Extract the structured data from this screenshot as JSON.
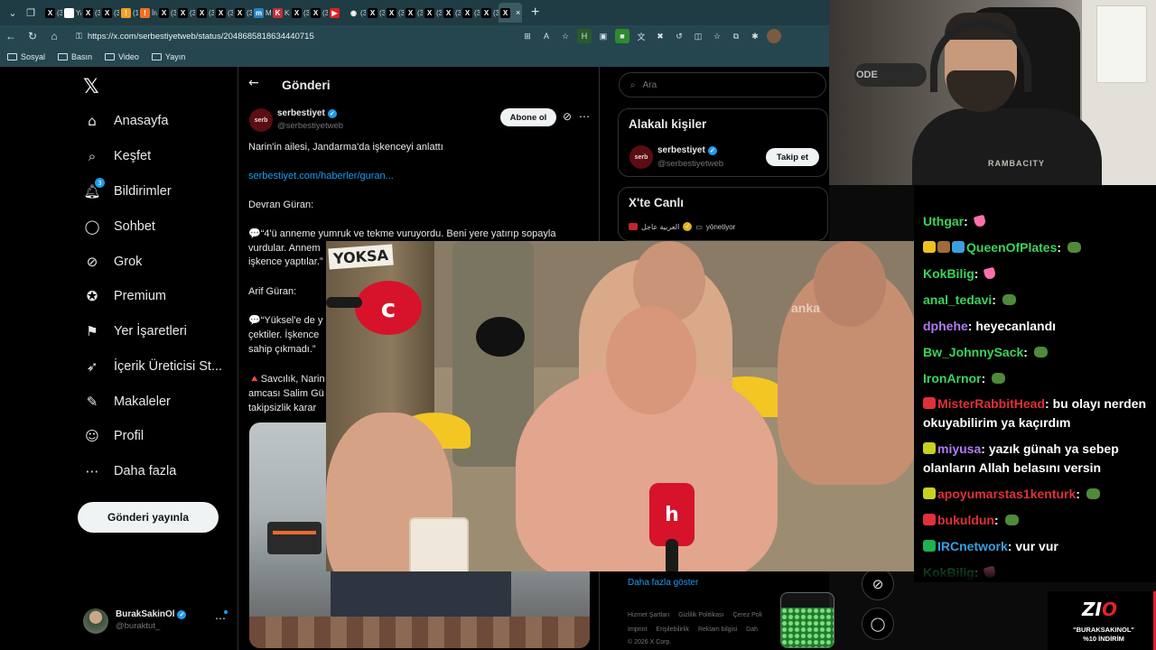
{
  "browser": {
    "tabs": [
      {
        "icon": "X",
        "label": "(3)",
        "color": "#000000"
      },
      {
        "icon": "Y",
        "label": "Yak",
        "color": "#ffffff"
      },
      {
        "icon": "X",
        "label": "(3)",
        "color": "#000000"
      },
      {
        "icon": "X",
        "label": "(3)",
        "color": "#000000"
      },
      {
        "icon": "!",
        "label": "(13",
        "color": "#f0a020"
      },
      {
        "icon": "!",
        "label": "İrar",
        "color": "#f07020"
      },
      {
        "icon": "X",
        "label": "(3)",
        "color": "#000000"
      },
      {
        "icon": "X",
        "label": "(3)",
        "color": "#000000"
      },
      {
        "icon": "X",
        "label": "(3)",
        "color": "#000000"
      },
      {
        "icon": "X",
        "label": "(3)",
        "color": "#000000"
      },
      {
        "icon": "X",
        "label": "(3)",
        "color": "#000000"
      },
      {
        "icon": "m",
        "label": "Mir",
        "color": "#2a7fc0"
      },
      {
        "icon": "K",
        "label": "Kicl",
        "color": "#c0303a"
      },
      {
        "icon": "X",
        "label": "(3)",
        "color": "#000000"
      },
      {
        "icon": "X",
        "label": "(3)",
        "color": "#000000"
      },
      {
        "icon": "▶",
        "label": "",
        "color": "#e02020"
      },
      {
        "icon": "◉",
        "label": "(3)",
        "color": "#1f3b44"
      },
      {
        "icon": "X",
        "label": "(3)",
        "color": "#000000"
      },
      {
        "icon": "X",
        "label": "(3)",
        "color": "#000000"
      },
      {
        "icon": "X",
        "label": "(3)",
        "color": "#000000"
      },
      {
        "icon": "X",
        "label": "(3)",
        "color": "#000000"
      },
      {
        "icon": "X",
        "label": "(3)",
        "color": "#000000"
      },
      {
        "icon": "X",
        "label": "(3)",
        "color": "#000000"
      },
      {
        "icon": "X",
        "label": "(3)",
        "color": "#000000"
      },
      {
        "icon": "X",
        "label": "",
        "color": "#000000",
        "active": true
      }
    ],
    "url": "https://x.com/serbestiyetweb/status/2048685818634440715",
    "bookmarks": [
      "Sosyal",
      "Basın",
      "Video",
      "Yayın"
    ]
  },
  "nav": {
    "items": [
      {
        "icon": "⌂",
        "label": "Anasayfa",
        "name": "home"
      },
      {
        "icon": "⌕",
        "label": "Keşfet",
        "name": "explore"
      },
      {
        "icon": "🔔︎",
        "label": "Bildirimler",
        "name": "notifications",
        "badge": "3"
      },
      {
        "icon": "◯",
        "label": "Sohbet",
        "name": "chat"
      },
      {
        "icon": "⊘",
        "label": "Grok",
        "name": "grok"
      },
      {
        "icon": "✪",
        "label": "Premium",
        "name": "premium"
      },
      {
        "icon": "⚑",
        "label": "Yer İşaretleri",
        "name": "bookmarks"
      },
      {
        "icon": "➶",
        "label": "İçerik Üreticisi St...",
        "name": "creator-studio"
      },
      {
        "icon": "✎",
        "label": "Makaleler",
        "name": "articles"
      },
      {
        "icon": "☺",
        "label": "Profil",
        "name": "profile"
      },
      {
        "icon": "⋯",
        "label": "Daha fazla",
        "name": "more"
      }
    ],
    "post_button": "Gönderi yayınla",
    "account": {
      "name": "BurakSakinOl",
      "handle": "@buraktut_"
    }
  },
  "post": {
    "header_title": "Gönderi",
    "author_name": "serbestiyet",
    "author_handle": "@serbestiyetweb",
    "logo_text": "serb",
    "subscribe": "Abone ol",
    "lines": {
      "headline": "Narin'in ailesi, Jandarma'da işkenceyi anlattı",
      "link": "serbestiyet.com/haberler/guran...",
      "speaker1": "Devran Güran:",
      "quote1": "💬“4'ü anneme yumruk ve tekme vuruyordu. Beni yere yatırıp sopayla vurdular. Annem",
      "quote1b": "işkence yaptılar.”",
      "speaker2": "Arif Güran:",
      "quote2a": "💬“Yüksel'e de y",
      "quote2b": "çektiler. İşkence",
      "quote2c": "sahip çıkmadı.”",
      "note_a": "🔺Savcılık, Narin",
      "note_b": "amcası Salim Gü",
      "note_c": "takipsizlik karar"
    }
  },
  "right": {
    "search_placeholder": "Ara",
    "relevant_title": "Alakalı kişiler",
    "relevant_person": {
      "name": "serbestiyet",
      "handle": "@serbestiyetweb",
      "button": "Takip et"
    },
    "live_title": "X'te Canlı",
    "live_row": {
      "channel": "العربية عاجل",
      "suffix": "yönetiyor"
    },
    "show_more": "Daha fazla göster",
    "footer_line1": [
      "Hizmet Şartları",
      "Gizlilik Politikası",
      "Çerez Poli"
    ],
    "footer_line2": [
      "Imprint",
      "Erişilebilirlik",
      "Reklam bilgisi",
      "Dah"
    ],
    "copyright": "© 2026 X Corp."
  },
  "video": {
    "sign_text": "YOKSA",
    "watermark": "anka",
    "mic1_label": "c",
    "mic2_label": "h"
  },
  "webcam": {
    "mic_brand": "ODE",
    "shirt_text": "RAMBACITY"
  },
  "chat": {
    "messages": [
      {
        "user": "Uthgar",
        "user_color": "#3ad45a",
        "text": "",
        "emote": "heart"
      },
      {
        "user": "QueenOfPlates",
        "user_color": "#3ad45a",
        "text": "",
        "emote": "frog",
        "badges": [
          "#f0c020",
          "#a06a3a",
          "#3a9fe0"
        ]
      },
      {
        "user": "KokBilig",
        "user_color": "#3ad45a",
        "text": "",
        "emote": "heart"
      },
      {
        "user": "anal_tedavi",
        "user_color": "#3ad45a",
        "text": "",
        "emote": "frog"
      },
      {
        "user": "dphehe",
        "user_color": "#b07cf5",
        "text": "heyecanlandı"
      },
      {
        "user": "Bw_JohnnySack",
        "user_color": "#3ad45a",
        "text": "",
        "emote": "frog"
      },
      {
        "user": "IronArnor",
        "user_color": "#3ad45a",
        "text": "",
        "emote": "frog"
      },
      {
        "user": "MisterRabbitHead",
        "user_color": "#e0303a",
        "text": "bu olayı nerden okuyabilirim ya kaçırdım",
        "badges": [
          "#e0303a"
        ]
      },
      {
        "user": "miyusa",
        "user_color": "#b07cf5",
        "text": "yazık günah ya sebep olanların Allah belasını versin",
        "badges": [
          "#c8d020"
        ]
      },
      {
        "user": "apoyumarstas1kenturk",
        "user_color": "#e0303a",
        "text": "",
        "emote": "frog",
        "badges": [
          "#c8d020"
        ]
      },
      {
        "user": "bukuldun",
        "user_color": "#e0303a",
        "text": "",
        "emote": "frog",
        "badges": [
          "#e0303a"
        ]
      },
      {
        "user": "IRCnetwork",
        "user_color": "#3a9fe0",
        "text": "vur vur",
        "badges": [
          "#20b050"
        ]
      },
      {
        "user": "KokBilig",
        "user_color": "#3ad45a",
        "text": "",
        "emote": "heart"
      }
    ]
  },
  "sponsor": {
    "brand_main": "ZI",
    "brand_accent": "O",
    "code": "\"BURAKSAKINOL\"",
    "discount": "%10 İNDİRİM"
  }
}
